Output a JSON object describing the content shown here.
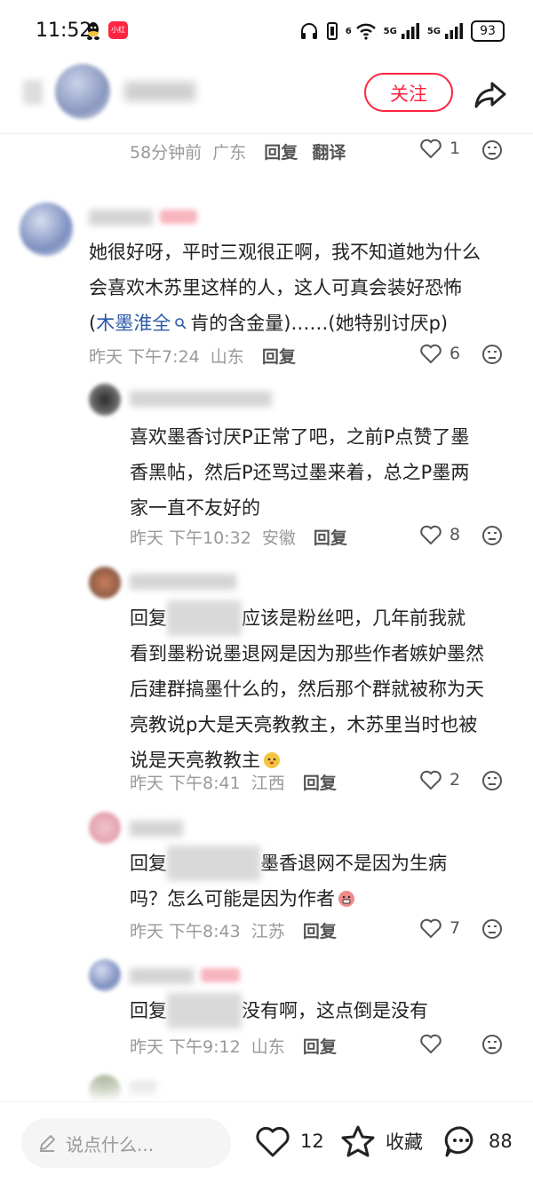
{
  "status_bar": {
    "time": "11:52",
    "battery": "93",
    "signal_1": "5G",
    "signal_2": "5G",
    "wifi_tag": "6"
  },
  "header": {
    "follow_label": "关注"
  },
  "comments": [
    {
      "time": "58分钟前",
      "location": "广东",
      "reply_label": "回复",
      "translate_label": "翻译",
      "likes": "1"
    },
    {
      "text_line1": "她很好呀，平时三观很正啊，我不知道她为什么",
      "text_line2_a": "会喜欢木苏里这样的人，这人可真会装",
      "text_line2_b": "好恐怖",
      "text_line3_link": "木墨淮全",
      "text_line3_b": "肯的含金量)……(她特别讨厌p)",
      "time": "昨天 下午7:24",
      "location": "山东",
      "reply_label": "回复",
      "likes": "6"
    },
    {
      "text_line1": "喜欢墨香讨厌P正常了吧，之前P点赞了墨",
      "text_line2": "香黑帖，然后P还骂过墨来着，总之P墨两",
      "text_line3": "家一直不友好的",
      "time": "昨天 下午10:32",
      "location": "安徽",
      "reply_label": "回复",
      "likes": "8"
    },
    {
      "reply_prefix": "回复",
      "text_line1": "应该是粉丝吧，几年前我就",
      "text_line2": "看到墨粉说墨退网是因为那些作者嫉妒墨然",
      "text_line3": "后建群搞墨什么的，然后那个群就被称为天",
      "text_line4": "亮教说p大是天亮教教主，木苏里当时也被",
      "text_line5": "说是天亮教教主",
      "time": "昨天 下午8:41",
      "location": "江西",
      "reply_label": "回复",
      "likes": "2"
    },
    {
      "reply_prefix": "回复",
      "text_line1": "墨香退网不是因为生病",
      "text_line2": "吗？怎么可能是因为作者",
      "time": "昨天 下午8:43",
      "location": "江苏",
      "reply_label": "回复",
      "likes": "7"
    },
    {
      "reply_prefix": "回复",
      "text_line1": "没有啊，这点倒是没有",
      "time": "昨天 下午9:12",
      "location": "山东",
      "reply_label": "回复",
      "likes": ""
    }
  ],
  "bottom_bar": {
    "input_placeholder": "说点什么...",
    "likes": "12",
    "collect_label": "收藏",
    "comments_count": "88"
  }
}
